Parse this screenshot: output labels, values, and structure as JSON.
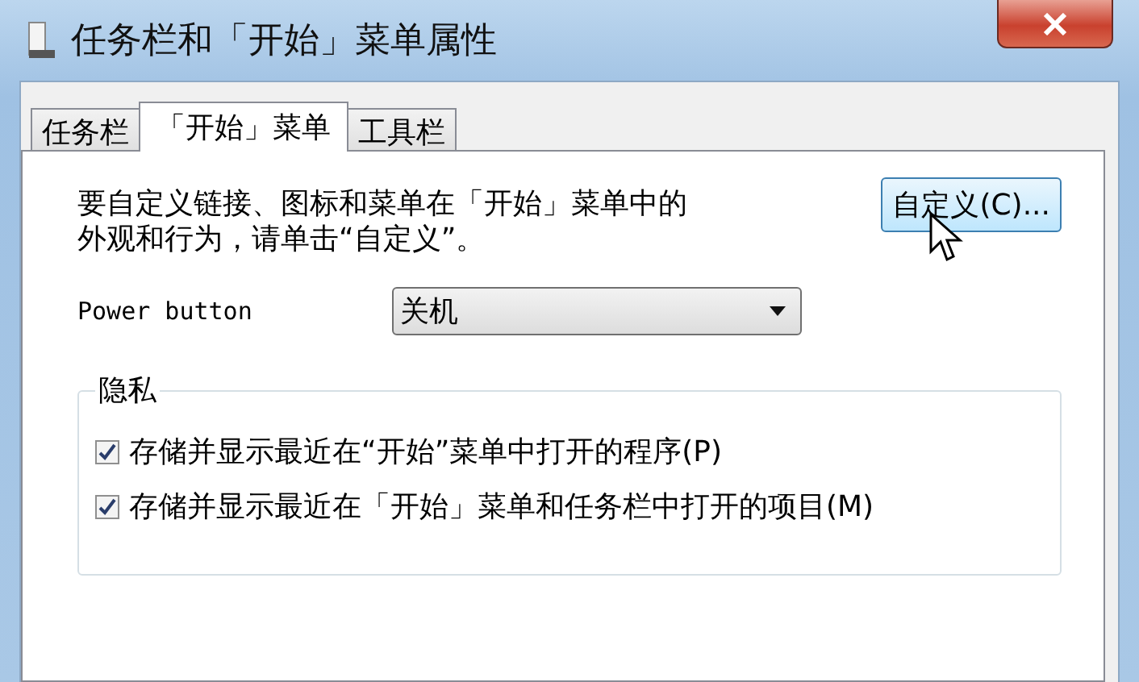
{
  "window": {
    "title": "任务栏和「开始」菜单属性"
  },
  "tabs": [
    {
      "label": "任务栏",
      "selected": false
    },
    {
      "label": "「开始」菜单",
      "selected": true
    },
    {
      "label": "工具栏",
      "selected": false
    }
  ],
  "description": "要自定义链接、图标和菜单在「开始」菜单中的外观和行为，请单击“自定义”。",
  "customize_button": "自定义(C)...",
  "power_button": {
    "label": "Power button",
    "value": "关机"
  },
  "privacy": {
    "title": "隐私",
    "options": [
      {
        "label": "存储并显示最近在“开始”菜单中打开的程序(P)",
        "checked": true
      },
      {
        "label": "存储并显示最近在「开始」菜单和任务栏中打开的项目(M)",
        "checked": true
      }
    ]
  }
}
